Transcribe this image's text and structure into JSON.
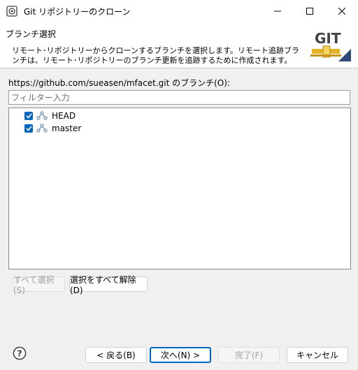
{
  "window": {
    "title": "Git リポジトリーのクローン"
  },
  "header": {
    "title": "ブランチ選択",
    "description": "リモート･リポジトリーからクローンするブランチを選択します。リモート追跡ブランチは、リモート･リポジトリーのブランチ更新を追跡するために作成されます。",
    "logo_text": "GIT"
  },
  "branches_label": "https://github.com/sueasen/mfacet.git のブランチ(O):",
  "filter": {
    "placeholder": "フィルター入力",
    "value": ""
  },
  "branches": [
    {
      "name": "HEAD",
      "checked": true
    },
    {
      "name": "master",
      "checked": true
    }
  ],
  "buttons": {
    "select_all": "すべて選択(S)",
    "deselect_all": "選択をすべて解除(D)",
    "back": "< 戻る(B)",
    "next": "次へ(N) >",
    "finish": "完了(F)",
    "cancel": "キャンセル"
  },
  "colors": {
    "accent": "#0067c0",
    "branch_icon": "#6b8fb5"
  }
}
